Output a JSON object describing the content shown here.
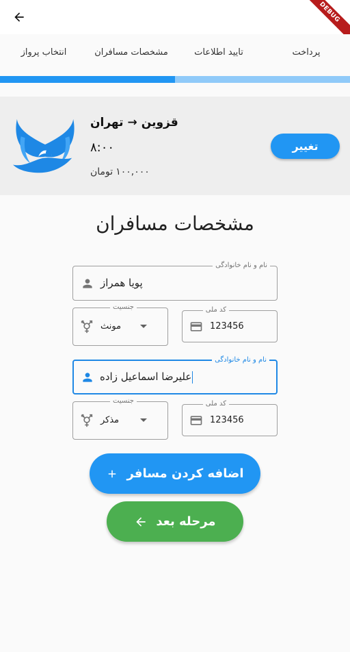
{
  "appbar": {
    "back_icon": "arrow-back-icon",
    "debug_banner": "DEBUG"
  },
  "steps": [
    {
      "label": "پرداخت"
    },
    {
      "label": "تایید اطلاعات"
    },
    {
      "label": "مشخصات مسافران"
    },
    {
      "label": "انتخاب پرواز"
    }
  ],
  "progress": {
    "fraction": 0.5
  },
  "flight": {
    "origin": "تهران",
    "arrow": "→",
    "destination": "قزوین",
    "time": "۸:۰۰",
    "price": "۱۰۰,۰۰۰",
    "currency": "تومان",
    "change_label": "تغییر"
  },
  "form": {
    "title": "مشخصات مسافران",
    "passengers": [
      {
        "name_label": "نام و نام خانوادگی",
        "name_value": "پویا همراز",
        "gender_label": "جنسیت",
        "gender_value": "مونث",
        "national_id_label": "کد ملی",
        "national_id_value": "123456"
      },
      {
        "name_label": "نام و نام خانوادگی",
        "name_value": "علیرضا اسماعیل زاده",
        "gender_label": "جنسیت",
        "gender_value": "مذکر",
        "national_id_label": "کد ملی",
        "national_id_value": "123456"
      }
    ]
  },
  "actions": {
    "add_passenger_label": "اضافه کردن مسافر",
    "add_icon": "plus-icon",
    "next_label": "مرحله بعد",
    "next_icon": "arrow-left-icon"
  },
  "colors": {
    "primary": "#2196f3",
    "progress_track": "#90caf9",
    "success": "#4caf50",
    "card_bg": "#eeeeee",
    "focus": "#1e88e5"
  }
}
